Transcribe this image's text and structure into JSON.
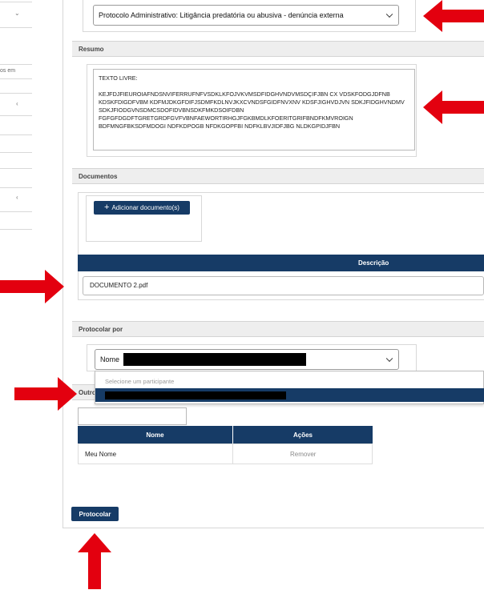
{
  "sidebar": {
    "fragment_text": "os em"
  },
  "protocol_type": {
    "selected": "Protocolo Administrativo: Litigância predatória ou abusiva - denúncia externa"
  },
  "resumo": {
    "section_title": "Resumo",
    "text": "TEXTO LIVRE:\n\nKEJFDJFIEUROIAFNDSNVIFERRUFNFVSDKLKFOJVKVMSDFIDGHVNDVMSDÇIFJBN CX VDSKFODGJDFNB KDSKFDIGDFVBM KDFMJDKGFDIFJSDMFKDLNVJKXCVNDSFGIDFNVXNV KDSFJIGHVDJVN SDKJFIDGHVNDMV SDKJFIODGVNSDMCSDOFIDVBNSDKFMKDSOIFDBN FGFGFDGDFTGRETGRDFGVFVBNFAEWORTIRHGJFGKBMDLKFOERITGRIFBNDFKMVROIGN BDFMNGFBKSDFMDOGI NDFKDPOGB NFDKGOPFBI NDFKLBVJIDFJBG NLDKGPIDJFBN"
  },
  "documentos": {
    "section_title": "Documentos",
    "add_button": "Adicionar documento(s)",
    "column_header": "Descrição",
    "file_name": "DOCUMENTO 2.pdf"
  },
  "protocolar_por": {
    "section_title": "Protocolar por",
    "select_prefix": "Nome",
    "dropdown_placeholder": "Selecione um participante"
  },
  "outros": {
    "section_title_visible": "Outro",
    "table": {
      "headers": [
        "Nome",
        "Ações"
      ],
      "rows": [
        {
          "nome": "Meu Nome",
          "acao": "Remover"
        }
      ]
    }
  },
  "footer": {
    "submit_button": "Protocolar"
  },
  "colors": {
    "primary": "#163b66",
    "annotation_arrow": "#e3000f"
  }
}
